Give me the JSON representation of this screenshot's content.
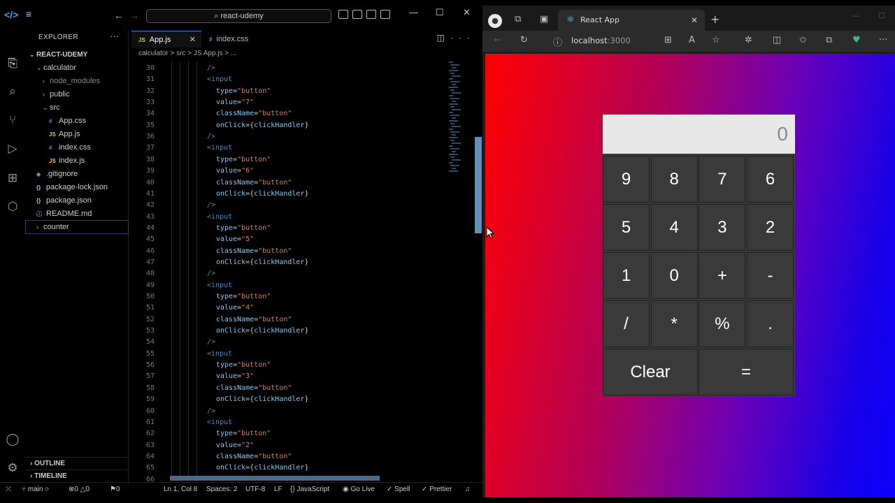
{
  "vscode": {
    "search_title": "react-udemy",
    "explorer_title": "EXPLORER",
    "project_root": "REACT-UDEMY",
    "tree": [
      {
        "label": "calculator",
        "kind": "folder-open"
      },
      {
        "label": "node_modules",
        "kind": "folder"
      },
      {
        "label": "public",
        "kind": "folder"
      },
      {
        "label": "src",
        "kind": "folder-open"
      },
      {
        "label": "App.css",
        "kind": "css"
      },
      {
        "label": "App.js",
        "kind": "js"
      },
      {
        "label": "index.css",
        "kind": "css"
      },
      {
        "label": "index.js",
        "kind": "js"
      },
      {
        "label": ".gitignore",
        "kind": "git"
      },
      {
        "label": "package-lock.json",
        "kind": "json"
      },
      {
        "label": "package.json",
        "kind": "json"
      },
      {
        "label": "README.md",
        "kind": "info"
      },
      {
        "label": "counter",
        "kind": "folder"
      }
    ],
    "outline_label": "OUTLINE",
    "timeline_label": "TIMELINE",
    "tabs": [
      {
        "label": "App.js",
        "type": "JS"
      },
      {
        "label": "index.css",
        "type": "#"
      }
    ],
    "breadcrumb": "calculator > src > JS App.js > ...",
    "code_lines": [
      {
        "n": "30",
        "indent": 0,
        "t": "/>"
      },
      {
        "n": "31",
        "indent": 0,
        "t": "<input"
      },
      {
        "n": "32",
        "indent": 1,
        "t": "type=\"button\""
      },
      {
        "n": "33",
        "indent": 1,
        "t": "value=\"7\""
      },
      {
        "n": "34",
        "indent": 1,
        "t": "className=\"button\""
      },
      {
        "n": "35",
        "indent": 1,
        "t": "onClick={clickHandler}"
      },
      {
        "n": "36",
        "indent": 0,
        "t": "/>"
      },
      {
        "n": "37",
        "indent": 0,
        "t": "<input"
      },
      {
        "n": "38",
        "indent": 1,
        "t": "type=\"button\""
      },
      {
        "n": "39",
        "indent": 1,
        "t": "value=\"6\""
      },
      {
        "n": "40",
        "indent": 1,
        "t": "className=\"button\""
      },
      {
        "n": "41",
        "indent": 1,
        "t": "onClick={clickHandler}"
      },
      {
        "n": "42",
        "indent": 0,
        "t": "/>"
      },
      {
        "n": "43",
        "indent": 0,
        "t": "<input"
      },
      {
        "n": "44",
        "indent": 1,
        "t": "type=\"button\""
      },
      {
        "n": "45",
        "indent": 1,
        "t": "value=\"5\""
      },
      {
        "n": "46",
        "indent": 1,
        "t": "className=\"button\""
      },
      {
        "n": "47",
        "indent": 1,
        "t": "onClick={clickHandler}"
      },
      {
        "n": "48",
        "indent": 0,
        "t": "/>"
      },
      {
        "n": "49",
        "indent": 0,
        "t": "<input"
      },
      {
        "n": "50",
        "indent": 1,
        "t": "type=\"button\""
      },
      {
        "n": "51",
        "indent": 1,
        "t": "value=\"4\""
      },
      {
        "n": "52",
        "indent": 1,
        "t": "className=\"button\""
      },
      {
        "n": "53",
        "indent": 1,
        "t": "onClick={clickHandler}"
      },
      {
        "n": "54",
        "indent": 0,
        "t": "/>"
      },
      {
        "n": "55",
        "indent": 0,
        "t": "<input"
      },
      {
        "n": "56",
        "indent": 1,
        "t": "type=\"button\""
      },
      {
        "n": "57",
        "indent": 1,
        "t": "value=\"3\""
      },
      {
        "n": "58",
        "indent": 1,
        "t": "className=\"button\""
      },
      {
        "n": "59",
        "indent": 1,
        "t": "onClick={clickHandler}"
      },
      {
        "n": "60",
        "indent": 0,
        "t": "/>"
      },
      {
        "n": "61",
        "indent": 0,
        "t": "<input"
      },
      {
        "n": "62",
        "indent": 1,
        "t": "type=\"button\""
      },
      {
        "n": "63",
        "indent": 1,
        "t": "value=\"2\""
      },
      {
        "n": "64",
        "indent": 1,
        "t": "className=\"button\""
      },
      {
        "n": "65",
        "indent": 1,
        "t": "onClick={clickHandler}"
      },
      {
        "n": "66",
        "indent": 0,
        "t": ""
      }
    ],
    "status": {
      "branch": "main",
      "errors": "0",
      "warnings": "0",
      "ports": "0",
      "position": "Ln 1, Col 8",
      "spaces": "Spaces: 2",
      "encoding": "UTF-8",
      "eol": "LF",
      "language": "JavaScript",
      "golive": "Go Live",
      "spell": "Spell",
      "prettier": "Prettier"
    },
    "colors": {
      "accent": "#3a7bd5",
      "js": "#e4c44a",
      "css": "#4a9bd6"
    }
  },
  "browser": {
    "tab_title": "React App",
    "url_host": "localhost",
    "url_port": ":3000",
    "calculator": {
      "display": "0",
      "keys": [
        "9",
        "8",
        "7",
        "6",
        "5",
        "4",
        "3",
        "2",
        "1",
        "0",
        "+",
        "-",
        "/",
        "*",
        "%",
        "."
      ],
      "clear": "Clear",
      "equals": "="
    },
    "colors": {
      "gradient_start": "#ff0000",
      "gradient_end": "#0d00ff",
      "display_bg": "#e8e8e8",
      "key_bg": "#3a3a3a"
    }
  }
}
